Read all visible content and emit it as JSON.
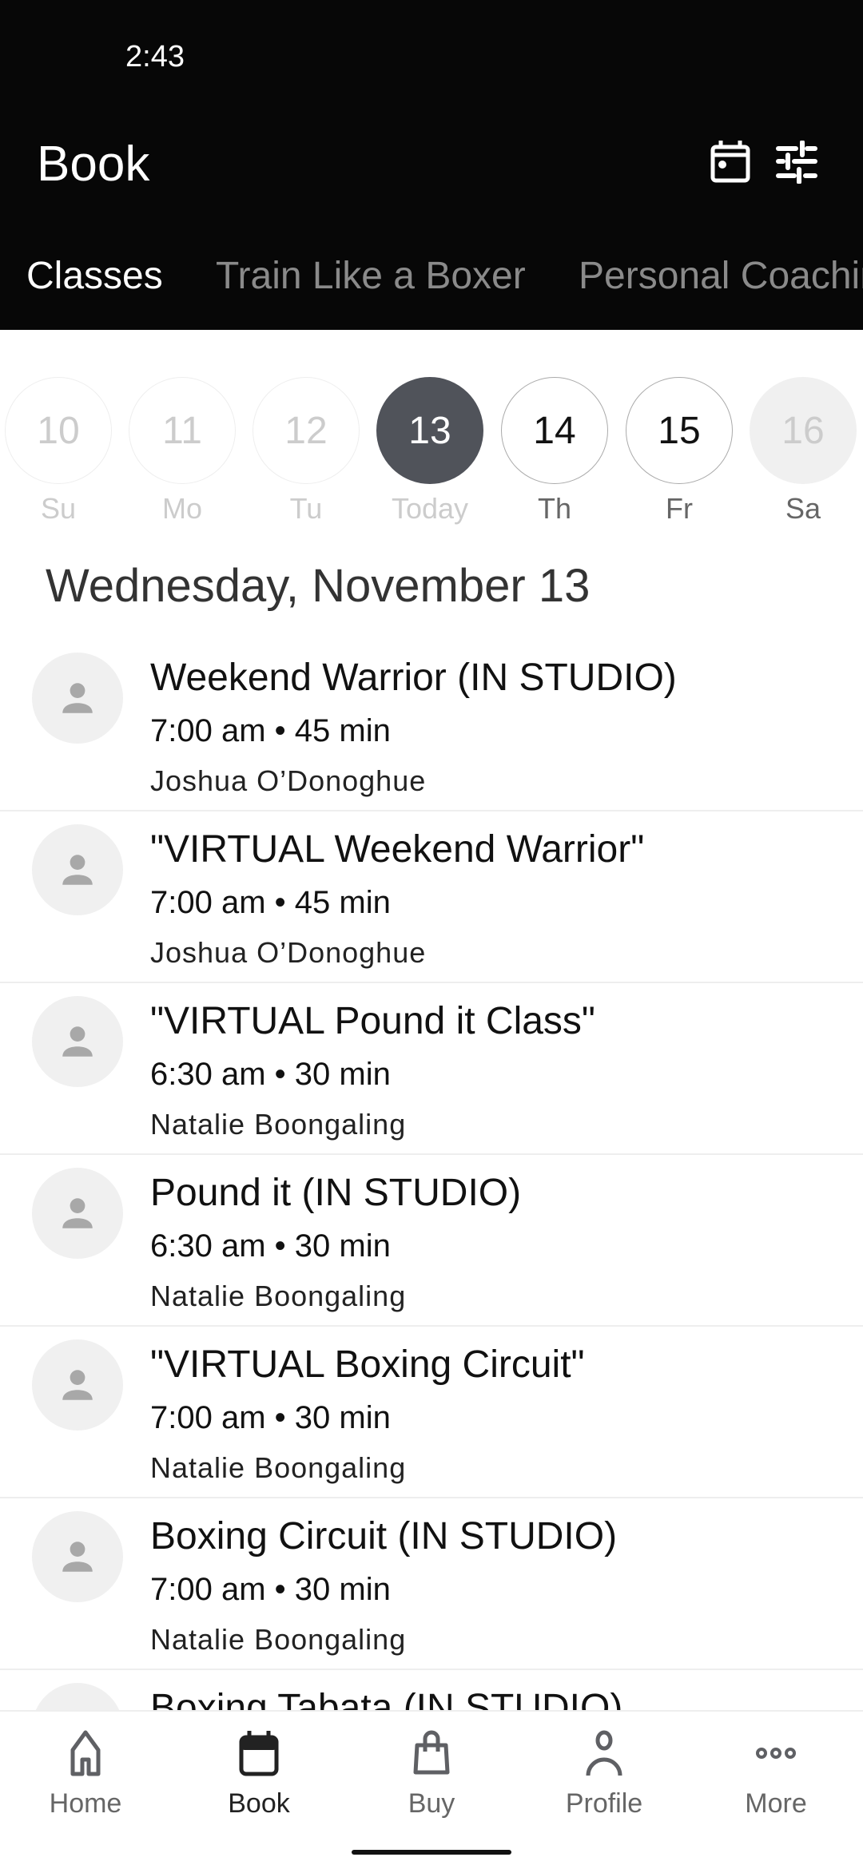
{
  "status_bar": {
    "time": "2:43"
  },
  "header": {
    "title": "Book",
    "icons": [
      "calendar-icon",
      "filter-sliders-icon"
    ]
  },
  "tabs": [
    {
      "label": "Classes",
      "active": true
    },
    {
      "label": "Train Like a Boxer"
    },
    {
      "label": "Personal Coaching"
    }
  ],
  "date_strip": [
    {
      "num": "10",
      "label": "Su",
      "state": "past"
    },
    {
      "num": "11",
      "label": "Mo",
      "state": "past"
    },
    {
      "num": "12",
      "label": "Tu",
      "state": "past"
    },
    {
      "num": "13",
      "label": "Today",
      "state": "selected"
    },
    {
      "num": "14",
      "label": "Th",
      "state": "future"
    },
    {
      "num": "15",
      "label": "Fr",
      "state": "future"
    },
    {
      "num": "16",
      "label": "Sa",
      "state": "disabled"
    }
  ],
  "date_heading": "Wednesday, November 13",
  "classes": [
    {
      "title": "Weekend Warrior (IN STUDIO)",
      "time": "7:00 am • 45 min",
      "instructor": "Joshua O’Donoghue"
    },
    {
      "title": "\"VIRTUAL Weekend Warrior\"",
      "time": "7:00 am • 45 min",
      "instructor": "Joshua O’Donoghue"
    },
    {
      "title": "\"VIRTUAL Pound it Class\"",
      "time": "6:30 am • 30 min",
      "instructor": "Natalie Boongaling"
    },
    {
      "title": "Pound it (IN STUDIO)",
      "time": "6:30 am • 30 min",
      "instructor": "Natalie Boongaling"
    },
    {
      "title": "\"VIRTUAL Boxing Circuit\"",
      "time": "7:00 am • 30 min",
      "instructor": "Natalie Boongaling"
    },
    {
      "title": "Boxing Circuit (IN STUDIO)",
      "time": "7:00 am • 30 min",
      "instructor": "Natalie Boongaling"
    },
    {
      "title": "Boxing Tabata (IN STUDIO)"
    }
  ],
  "bottom_nav": [
    {
      "label": "Home",
      "icon": "home-icon"
    },
    {
      "label": "Book",
      "icon": "calendar-icon",
      "active": true
    },
    {
      "label": "Buy",
      "icon": "shopping-bag-icon"
    },
    {
      "label": "Profile",
      "icon": "person-icon"
    },
    {
      "label": "More",
      "icon": "more-dots-icon"
    }
  ]
}
